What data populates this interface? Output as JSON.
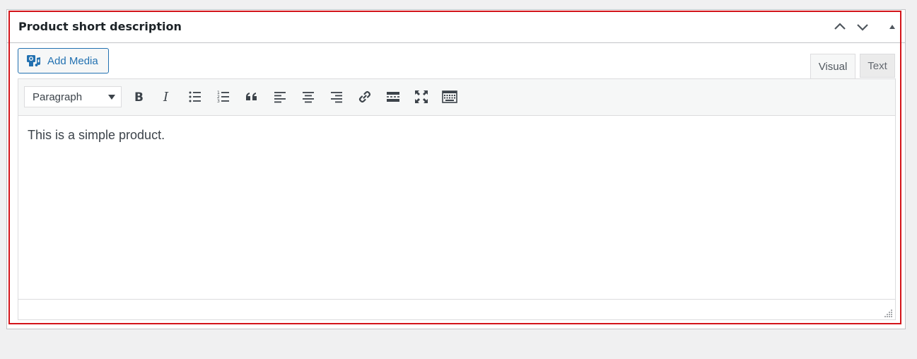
{
  "metabox": {
    "title": "Product short description",
    "move_up_icon": "chevron-up-icon",
    "move_down_icon": "chevron-down-icon",
    "toggle_icon": "triangle-up-icon"
  },
  "media": {
    "add_media_label": "Add Media",
    "icon": "add-media-icon"
  },
  "tabs": [
    {
      "label": "Visual",
      "active": true
    },
    {
      "label": "Text",
      "active": false
    }
  ],
  "toolbar": {
    "format_value": "Paragraph",
    "buttons": [
      "bold-icon",
      "italic-icon",
      "bulleted-list-icon",
      "numbered-list-icon",
      "blockquote-icon",
      "align-left-icon",
      "align-center-icon",
      "align-right-icon",
      "link-icon",
      "read-more-icon",
      "fullscreen-icon",
      "toolbar-toggle-icon"
    ]
  },
  "editor": {
    "content": "This is a simple product."
  },
  "colors": {
    "accent": "#2271b1",
    "highlight": "#d3141a",
    "border": "#c3c4c7"
  }
}
